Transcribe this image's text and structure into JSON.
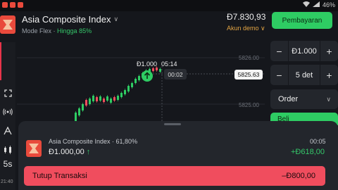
{
  "status_bar": {
    "time": "",
    "battery": "46%"
  },
  "header": {
    "asset": "Asia Composite Index",
    "mode": "Mode Flex",
    "profit_prefix": "Hingga ",
    "profit": "85%",
    "balance": "Ɖ7.830,93",
    "account": "Akun demo",
    "pay_button": "Pembayaran"
  },
  "chart": {
    "price_tag": "5825.63",
    "y_ticks": [
      "5826.00",
      "5825.00"
    ],
    "deal_amount": "Ɖ1.000",
    "deal_time": "05:14",
    "timer": "00:02"
  },
  "right_panel": {
    "amount": "Ɖ1.000",
    "duration": "5 det",
    "order_label": "Order",
    "buy_label": "Beli"
  },
  "left_toolbar": {
    "interval": "5s",
    "clock": "21:40"
  },
  "trade": {
    "asset": "Asia Composite Index · 61,80%",
    "amount": "Ɖ1.000,00",
    "direction": "↑",
    "timer": "00:05",
    "profit": "+Ɖ618,00",
    "close_label": "Tutup Transaksi",
    "close_amount": "–Ɖ800,00"
  },
  "colors": {
    "green": "#2ecc63",
    "red": "#f04d5e",
    "brand": "#e94a3c",
    "accent": "#e2a443"
  },
  "icons": [
    "chevron-down-icon",
    "expand-icon",
    "signal-icon",
    "drawing-icon",
    "candles-icon",
    "trend-up-icon"
  ]
}
